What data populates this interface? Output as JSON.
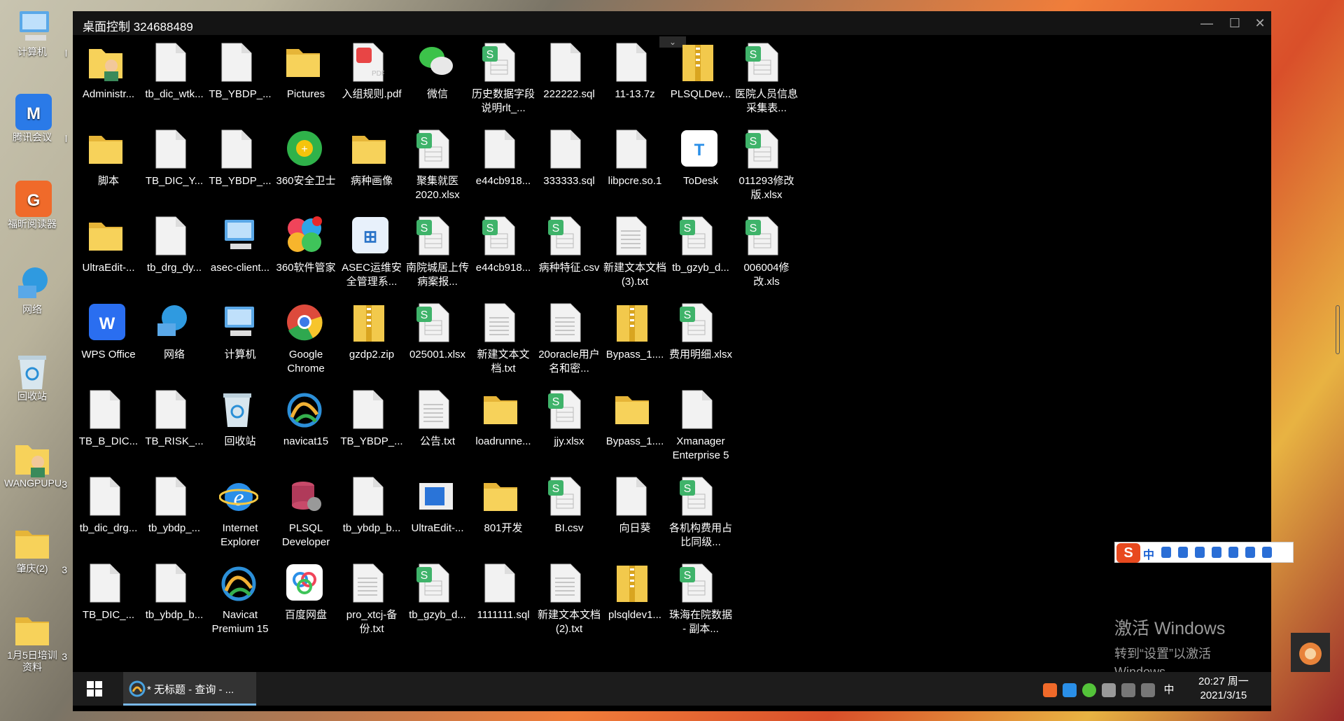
{
  "host_desktop": {
    "icons": [
      {
        "label": "计算机",
        "icon": "computer-icon"
      },
      {
        "label": "腾讯会议",
        "icon": "tencent-meeting-icon"
      },
      {
        "label": "福昕阅读器",
        "icon": "foxit-reader-icon"
      },
      {
        "label": "网络",
        "icon": "network-icon"
      },
      {
        "label": "回收站",
        "icon": "recycle-bin-icon"
      },
      {
        "label": "WANGPUPU",
        "icon": "user-folder-icon"
      },
      {
        "label": "肇庆(2)",
        "icon": "folder-icon"
      },
      {
        "label": "1月5日培训资料",
        "icon": "folder-icon"
      }
    ],
    "edge_chars": [
      "l",
      "l",
      "",
      "",
      "",
      "3",
      "3",
      "3"
    ]
  },
  "remote_window": {
    "title": "桌面控制 324688489",
    "controls": [
      "—",
      "☐",
      "✕"
    ],
    "collapse_glyph": "⌄"
  },
  "desktop_icons": [
    {
      "label": "Administr...",
      "type": "user-folder"
    },
    {
      "label": "tb_dic_wtk...",
      "type": "file"
    },
    {
      "label": "TB_YBDP_...",
      "type": "file"
    },
    {
      "label": "Pictures",
      "type": "folder"
    },
    {
      "label": "入组规则.pdf",
      "type": "pdf"
    },
    {
      "label": "微信",
      "type": "wechat"
    },
    {
      "label": "历史数据字段说明rlt_...",
      "type": "sheet"
    },
    {
      "label": "222222.sql",
      "type": "file"
    },
    {
      "label": "11-13.7z",
      "type": "file"
    },
    {
      "label": "PLSQLDev...",
      "type": "zip"
    },
    {
      "label": "医院人员信息采集表...",
      "type": "sheet"
    },
    {
      "label": "脚本",
      "type": "folder"
    },
    {
      "label": "TB_DIC_Y...",
      "type": "file"
    },
    {
      "label": "TB_YBDP_...",
      "type": "file"
    },
    {
      "label": "360安全卫士",
      "type": "360"
    },
    {
      "label": "病种画像",
      "type": "folder"
    },
    {
      "label": "聚集就医2020.xlsx",
      "type": "sheet"
    },
    {
      "label": "e44cb918...",
      "type": "file"
    },
    {
      "label": "333333.sql",
      "type": "file"
    },
    {
      "label": "libpcre.so.1",
      "type": "file"
    },
    {
      "label": "ToDesk",
      "type": "todesk"
    },
    {
      "label": "011293修改版.xlsx",
      "type": "sheet"
    },
    {
      "label": "UltraEdit-...",
      "type": "folder"
    },
    {
      "label": "tb_drg_dy...",
      "type": "file"
    },
    {
      "label": "asec-client...",
      "type": "computer"
    },
    {
      "label": "360软件管家",
      "type": "softmgr"
    },
    {
      "label": "ASEC运维安全管理系...",
      "type": "asec"
    },
    {
      "label": "南院城居上传病案报...",
      "type": "sheet"
    },
    {
      "label": "e44cb918...",
      "type": "sheet"
    },
    {
      "label": "病种特征.csv",
      "type": "sheet"
    },
    {
      "label": "新建文本文档 (3).txt",
      "type": "txt"
    },
    {
      "label": "tb_gzyb_d...",
      "type": "sheet"
    },
    {
      "label": "006004修改.xls",
      "type": "sheet"
    },
    {
      "label": "WPS Office",
      "type": "wps"
    },
    {
      "label": "网络",
      "type": "network"
    },
    {
      "label": "计算机",
      "type": "computer"
    },
    {
      "label": "Google Chrome",
      "type": "chrome"
    },
    {
      "label": "gzdp2.zip",
      "type": "zip"
    },
    {
      "label": "025001.xlsx",
      "type": "sheet"
    },
    {
      "label": "新建文本文档.txt",
      "type": "txt"
    },
    {
      "label": "20oracle用户名和密...",
      "type": "txt"
    },
    {
      "label": "Bypass_1....",
      "type": "zip"
    },
    {
      "label": "费用明细.xlsx",
      "type": "sheet"
    },
    {
      "label": "TB_B_DIC...",
      "type": "file"
    },
    {
      "label": "TB_RISK_...",
      "type": "file"
    },
    {
      "label": "回收站",
      "type": "recycle"
    },
    {
      "label": "navicat15",
      "type": "navicat"
    },
    {
      "label": "TB_YBDP_...",
      "type": "file"
    },
    {
      "label": "公告.txt",
      "type": "txt"
    },
    {
      "label": "loadrunne...",
      "type": "folder"
    },
    {
      "label": "jjy.xlsx",
      "type": "sheet"
    },
    {
      "label": "Bypass_1....",
      "type": "folder"
    },
    {
      "label": "Xmanager Enterprise 5",
      "type": "file"
    },
    {
      "label": "tb_dic_drg...",
      "type": "file"
    },
    {
      "label": "tb_ybdp_...",
      "type": "file"
    },
    {
      "label": "Internet Explorer",
      "type": "ie"
    },
    {
      "label": "PLSQL Developer",
      "type": "plsql"
    },
    {
      "label": "tb_ybdp_b...",
      "type": "file"
    },
    {
      "label": "UltraEdit-...",
      "type": "ultraedit"
    },
    {
      "label": "801开发",
      "type": "folder"
    },
    {
      "label": "BI.csv",
      "type": "sheet"
    },
    {
      "label": "向日葵",
      "type": "file"
    },
    {
      "label": "各机构费用占比同级...",
      "type": "sheet"
    },
    {
      "label": "TB_DIC_...",
      "type": "file"
    },
    {
      "label": "tb_ybdp_b...",
      "type": "file"
    },
    {
      "label": "Navicat Premium 15",
      "type": "navicat"
    },
    {
      "label": "百度网盘",
      "type": "baidu"
    },
    {
      "label": "pro_xtcj-备份.txt",
      "type": "txt"
    },
    {
      "label": "tb_gzyb_d...",
      "type": "sheet"
    },
    {
      "label": "1111111.sql",
      "type": "file"
    },
    {
      "label": "新建文本文档 (2).txt",
      "type": "txt"
    },
    {
      "label": "plsqldev1...",
      "type": "zip"
    },
    {
      "label": "珠海在院数据 - 副本...",
      "type": "sheet"
    }
  ],
  "row_counts": [
    11,
    11,
    11,
    10,
    10,
    10,
    10
  ],
  "remote_taskbar": {
    "task_label": "* 无标题 - 查询 - ...",
    "ime_lang": "中",
    "clock_time": "20:27 周一",
    "clock_date": "2021/3/15"
  },
  "ime_toolbar": {
    "logo": "S",
    "lang": "中"
  },
  "activation": {
    "line1": "激活 Windows",
    "line2": "转到“设置”以激活 Windows。"
  },
  "colors": {
    "accent": "#7ab8e8",
    "sheet_green": "#3fb36a",
    "folder_yellow": "#f5c842",
    "remote_bg": "#000000"
  }
}
